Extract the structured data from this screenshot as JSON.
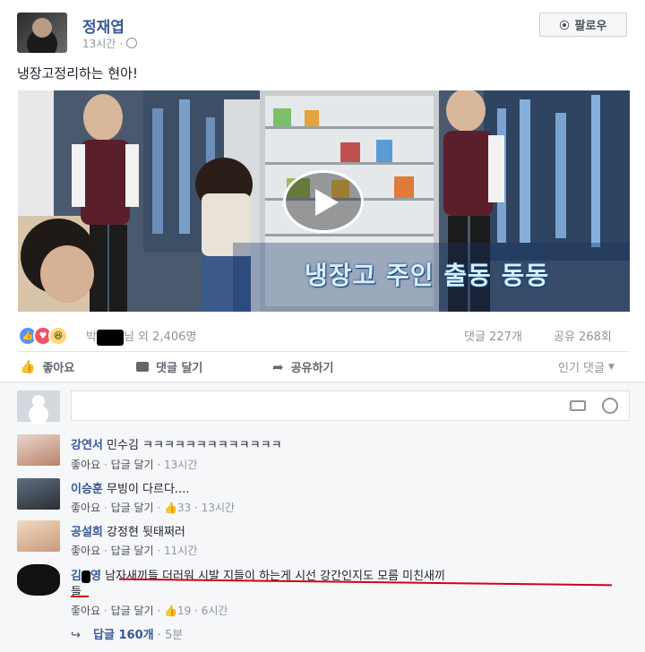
{
  "post": {
    "author": "정재엽",
    "time": "13시간",
    "privacy_icon": "globe-icon",
    "follow_label": "팔로우",
    "text": "냉장고정리하는 현아!",
    "video_caption": "냉장고 주인 출동 동동"
  },
  "reactions": {
    "names_prefix": "박",
    "names_suffix": "님 외 2,406명",
    "comments_count": "댓글 227개",
    "shares_count": "공유 268회"
  },
  "actions": {
    "like": "좋아요",
    "comment": "댓글 달기",
    "share": "공유하기",
    "sort": "인기 댓글"
  },
  "comments": [
    {
      "author": "강연서",
      "text": "민수김 ㅋㅋㅋㅋㅋㅋㅋㅋㅋㅋㅋㅋㅋ",
      "like": "좋아요",
      "reply": "답글 달기",
      "likes": "",
      "time": "13시간"
    },
    {
      "author": "이승훈",
      "text": "무빙이 다르다....",
      "like": "좋아요",
      "reply": "답글 달기",
      "likes": "33",
      "time": "13시간"
    },
    {
      "author": "공설희",
      "text": "강정현 뒷태쩌러",
      "like": "좋아요",
      "reply": "답글 달기",
      "likes": "",
      "time": "11시간"
    },
    {
      "author_prefix": "김",
      "author_suffix": "영",
      "text": "남자새끼들 더러워 시발 지들이 하는게 시선 강간인지도 모름 미친새끼",
      "text_cont": "들",
      "like": "좋아요",
      "reply": "답글 달기",
      "likes": "19",
      "time": "6시간",
      "replies_label": "답글 160개",
      "replies_time": "5분"
    }
  ],
  "colors": {
    "link": "#365899",
    "like_blue": "#5890ff",
    "love_red": "#f25268",
    "haha_yellow": "#ffd972",
    "annotation_red": "#d0021b"
  }
}
